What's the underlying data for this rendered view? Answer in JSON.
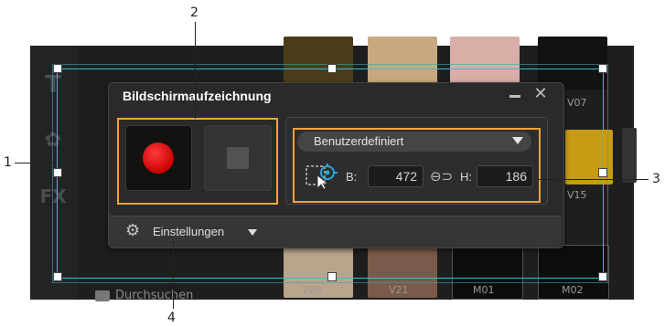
{
  "window": {
    "title": "Bildschirmaufzeichnung",
    "minimize_label": "minimize",
    "close_label": "close"
  },
  "capture": {
    "record_label": "Record",
    "stop_label": "Stop",
    "region_mode": "Benutzerdefiniert",
    "width_label": "B:",
    "width_value": "472",
    "height_label": "H:",
    "height_value": "186"
  },
  "settings": {
    "label": "Einstellungen"
  },
  "background_app": {
    "library_thumbnails": [
      "V07",
      "V15",
      "V20",
      "V21",
      "M01",
      "M02"
    ],
    "browse_label": "Durchsuchen",
    "sidebar_icons": [
      "title-icon",
      "graphic-icon",
      "fx-icon"
    ]
  },
  "callouts": [
    "1",
    "2",
    "3",
    "4"
  ],
  "colors": {
    "accent_orange": "#f2a33c",
    "selection_cyan": "#27c6d6",
    "record_red": "#d40000",
    "panel_bg": "#2a2a2a"
  }
}
